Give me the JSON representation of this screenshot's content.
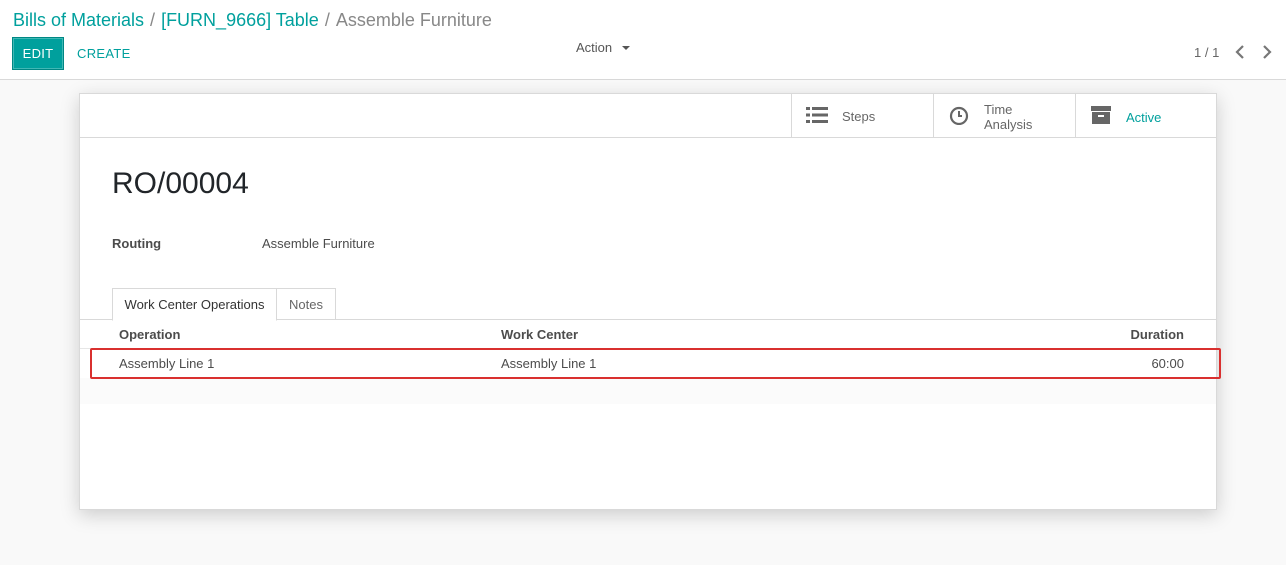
{
  "breadcrumb": {
    "items": [
      {
        "label": "Bills of Materials",
        "active": false
      },
      {
        "label": "[FURN_9666] Table",
        "active": false
      },
      {
        "label": "Assemble Furniture",
        "active": true
      }
    ],
    "separator": "/"
  },
  "toolbar": {
    "edit_label": "EDIT",
    "create_label": "CREATE",
    "action_label": "Action"
  },
  "pager": {
    "value": "1 / 1"
  },
  "stat_buttons": {
    "steps": {
      "label": "Steps",
      "icon": "list-icon"
    },
    "time_analysis": {
      "label_line1": "Time",
      "label_line2": "Analysis",
      "icon": "clock-icon"
    },
    "active": {
      "label": "Active",
      "icon": "archive-icon"
    }
  },
  "record": {
    "title": "RO/00004",
    "routing_label": "Routing",
    "routing_value": "Assemble Furniture"
  },
  "tabs": [
    {
      "label": "Work Center Operations",
      "active": true
    },
    {
      "label": "Notes",
      "active": false
    }
  ],
  "operations_table": {
    "columns": [
      "Operation",
      "Work Center",
      "Duration"
    ],
    "rows": [
      {
        "operation": "Assembly Line 1",
        "work_center": "Assembly Line 1",
        "duration": "60:00"
      }
    ]
  },
  "colors": {
    "accent": "#00a09d",
    "highlight": "#d9302f"
  }
}
